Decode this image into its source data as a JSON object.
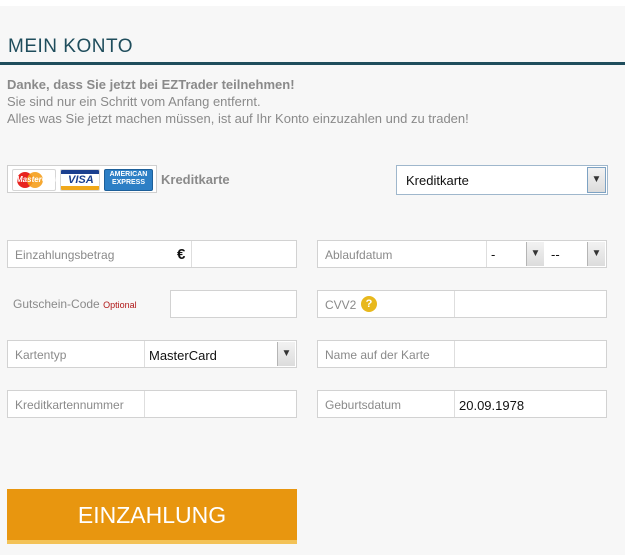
{
  "header": {
    "title": "MEIN KONTO"
  },
  "intro": {
    "line1": "Danke, dass Sie jetzt bei EZTrader teilnehmen!",
    "line2": "Sie sind nur ein Schritt vom Anfang entfernt.",
    "line3": "Alles was Sie jetzt machen müssen, ist auf Ihr Konto einzuzahlen und zu traden!"
  },
  "payment": {
    "cards_label": "Kreditkarte",
    "logos": {
      "mastercard": "MasterCard",
      "visa": "VISA",
      "amex": "AMERICAN EXPRESS"
    },
    "method_selected": "Kreditkarte"
  },
  "form": {
    "betrag_label": "Einzahlungsbetrag",
    "currency_symbol": "€",
    "gutschein_label": "Gutschein-Code",
    "gutschein_optional": "Optional",
    "kartentyp_label": "Kartentyp",
    "kartentyp_value": "MasterCard",
    "nummer_label": "Kreditkartennummer",
    "ablauf_label": "Ablaufdatum",
    "ablauf_month": "-",
    "ablauf_year": "--",
    "cvv_label": "CVV2",
    "cvv_help": "?",
    "name_label": "Name auf der Karte",
    "geburt_label": "Geburtsdatum",
    "geburt_value": "20.09.1978"
  },
  "submit": {
    "label": "EINZAHLUNG"
  },
  "colors": {
    "accent": "#e8960f",
    "title": "#1f4d5c",
    "optional": "#b01818",
    "help": "#e8b81c"
  }
}
